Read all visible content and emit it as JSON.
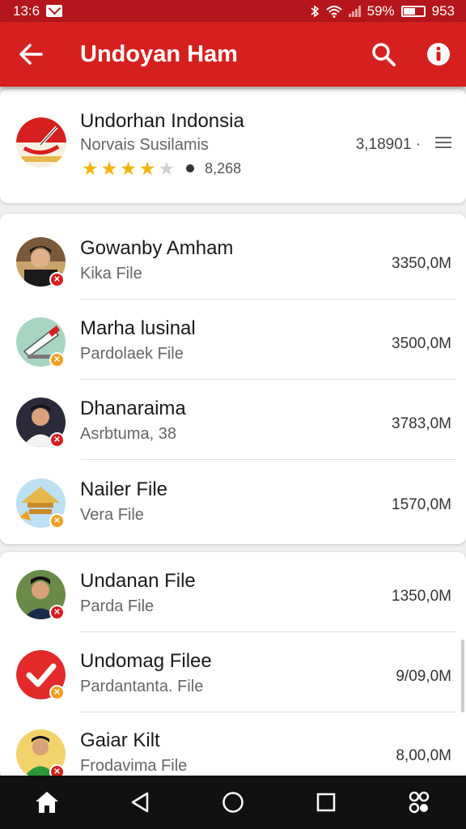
{
  "status_bar": {
    "time": "13:6",
    "battery_text": "59%",
    "right_text": "953",
    "battery_level": 0.59,
    "bluetooth_icon": "bluetooth-icon",
    "wifi_icon": "wifi-icon",
    "mail_icon": "mail-icon"
  },
  "app_bar": {
    "title": "Undoyan Ham",
    "back_icon": "arrow-back-icon",
    "search_icon": "search-icon",
    "info_icon": "info-icon",
    "background": "#d62020"
  },
  "featured": {
    "name": "Undorhan Indonsia",
    "subtitle": "Norvais Susilamis",
    "size": "3,18901 ·",
    "rating": 4,
    "rating_max": 5,
    "rating_count": "8,268",
    "star_color": "#f5b301"
  },
  "files": [
    {
      "title": "Gowanby Amham",
      "subtitle": "Kika File",
      "size": "3350,0M",
      "badge_color": "#d62020"
    },
    {
      "title": "Marha lusinal",
      "subtitle": "Pardolaek File",
      "size": "3500,0M",
      "badge_color": "#f0a020"
    },
    {
      "title": "Dhanaraima",
      "subtitle": "Asrbtuma, 38",
      "size": "3783,0M",
      "badge_color": "#d62020"
    },
    {
      "title": "Nailer File",
      "subtitle": "Vera File",
      "size": "1570,0M",
      "badge_color": "#f0a020"
    },
    {
      "title": "Undanan File",
      "subtitle": "Parda File",
      "size": "1350,0M",
      "badge_color": "#d62020"
    },
    {
      "title": "Undomag Filee",
      "subtitle": "Pardantanta. File",
      "size": "9/09,0M",
      "badge_color": "#f0a020"
    },
    {
      "title": "Gaiar Kilt",
      "subtitle": "Frodavima File",
      "size": "8,00,0M",
      "badge_color": "#d62020"
    }
  ],
  "nav": {
    "home_icon": "home-icon",
    "back_icon": "nav-back-icon",
    "home_circle_icon": "nav-home-circle-icon",
    "recents_icon": "recents-icon",
    "apps_icon": "apps-icon"
  }
}
